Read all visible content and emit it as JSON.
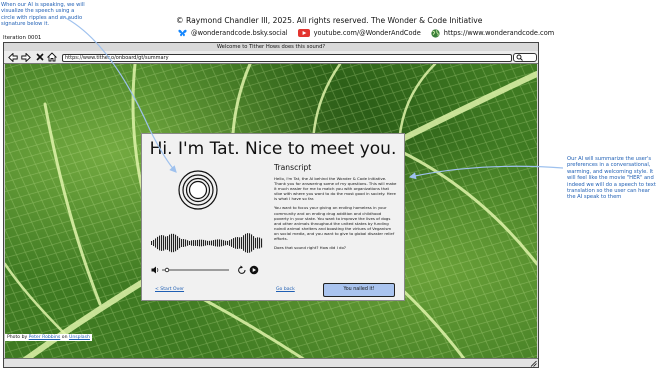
{
  "annotations": {
    "left": "When our AI is speaking, we will visualize the speech using a circle with ripples and an audio signature below it.",
    "right": "Our AI will summarize the user's preferences in a conversational, warming, and welcoming style. It will feel like the movie \"HER\" and indeed we will do a speech to text translation so the user can hear the AI speak to them"
  },
  "header": {
    "copyright": "© Raymond Chandler III, 2025. All rights reserved. The Wonder & Code Initiative",
    "social": {
      "bluesky": "@wonderandcode.bsky.social",
      "youtube": "youtube.com/@WonderAndCode",
      "web": "https://www.wonderandcode.com"
    },
    "iteration": "Iteration 0001"
  },
  "browser": {
    "title": "Welcome to Tither Hows does this sound?",
    "url": "https://www.tither.o/onboard/gt/summary"
  },
  "photo_credit": {
    "prefix": "Photo by ",
    "author": "Peter Robbins",
    "middle": " on ",
    "site": "Unsplash"
  },
  "card": {
    "title": "Hi. I'm Tat. Nice to meet you.",
    "transcript_heading": "Transcript",
    "transcript_paragraphs": [
      "Hello, I'm Tat, the AI behind the Wonder & Code Initiative. Thank you for answering some of my questions. This will make it much easier for me to match you with organizations that vibe with where you want to do the most good in society. Here is what I have so far.",
      "You want to focus your giving on ending homeless in your community and on ending drug addition and childhood poverty in your state. You want to improve the lives of dogs and other animals throughout the united states by funding noindl animal shelters and boosting the virtues of Veganism on social media, and you want to give to global disaster relief efforts.",
      "Does that sound right? How did I do?"
    ],
    "link_start_over": "< Start Over",
    "link_go_back": "Go back",
    "button_nailed": "You nailed it!"
  },
  "icons": {
    "bluesky": "butterfly-icon",
    "youtube": "youtube-play-icon",
    "web": "globe-icon",
    "back": "back-arrow-icon",
    "forward": "forward-arrow-icon",
    "stop": "close-icon",
    "home": "home-icon",
    "speaker": "speaker-icon",
    "replay": "replay-icon",
    "play": "play-icon"
  },
  "colors": {
    "annotation": "#1f5fb4",
    "button": "#aac4ef",
    "youtube": "#e3342f",
    "bluesky": "#1185fe"
  }
}
